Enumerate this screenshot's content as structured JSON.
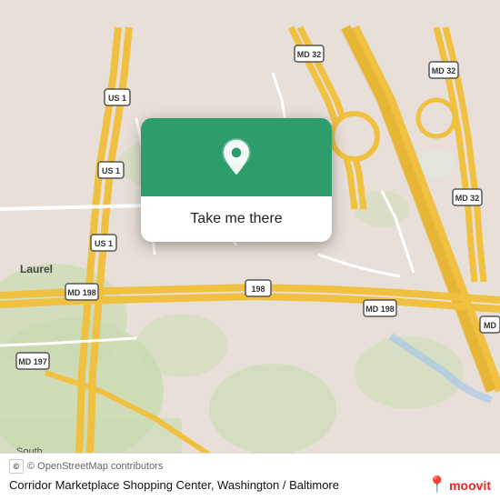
{
  "map": {
    "background_color": "#e8e0d8",
    "alt": "Map of Corridor Marketplace Shopping Center area, Washington/Baltimore"
  },
  "popup": {
    "button_label": "Take me there",
    "pin_icon": "location-pin-icon"
  },
  "bottom_bar": {
    "attribution": "© OpenStreetMap contributors",
    "address": "Corridor Marketplace Shopping Center, Washington /",
    "address_line2": "Baltimore",
    "logo_text": "moovit"
  },
  "road_labels": {
    "us1_top": "US 1",
    "us1_mid": "US 1",
    "us1_bot": "US 1",
    "md32_top": "MD 32",
    "md32_right": "MD 32",
    "md32_far": "MD 32",
    "md198_left": "MD 198",
    "md198_mid": "198",
    "md198_right": "MD 198",
    "md197": "MD 197",
    "md_right": "MD",
    "laurel": "Laurel",
    "south": "South"
  }
}
